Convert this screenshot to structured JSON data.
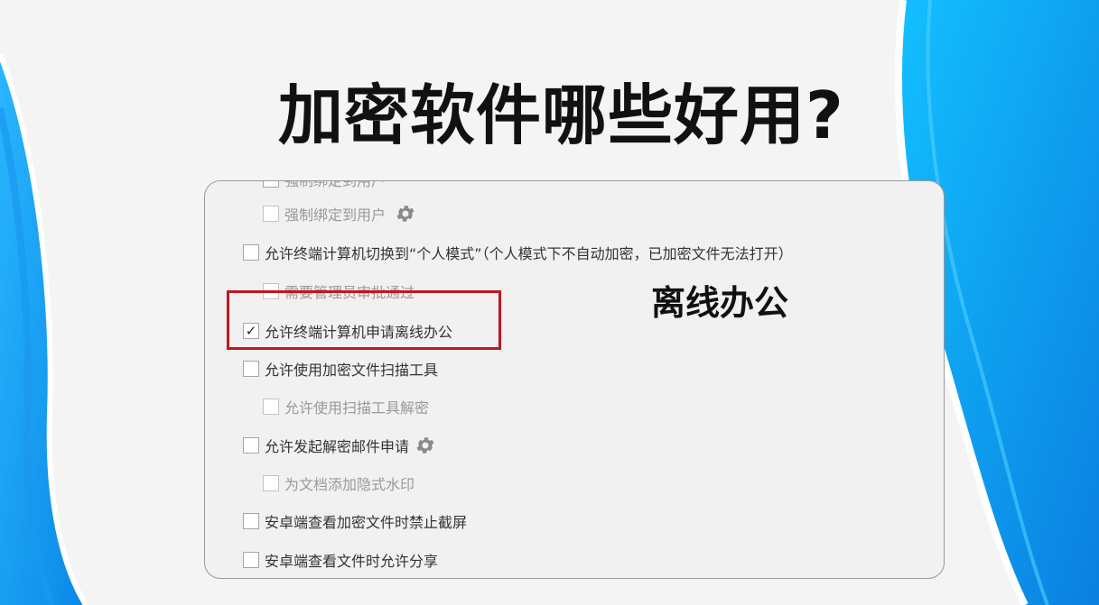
{
  "headline": "加密软件哪些好用?",
  "callout": "离线办公",
  "settings": {
    "clipped_label": "强制绑定到用户",
    "items": [
      {
        "label": "强制绑定到用户",
        "checked": false,
        "sub": true,
        "gear": true
      },
      {
        "label": "允许终端计算机切换到“个人模式”（个人模式下不自动加密，已加密文件无法打开）",
        "checked": false,
        "sub": false,
        "gear": false
      },
      {
        "label": "需要管理员审批通过",
        "checked": false,
        "sub": true,
        "gear": false
      },
      {
        "label": "允许终端计算机申请离线办公",
        "checked": true,
        "sub": false,
        "gear": false
      },
      {
        "label": "允许使用加密文件扫描工具",
        "checked": false,
        "sub": false,
        "gear": false
      },
      {
        "label": "允许使用扫描工具解密",
        "checked": false,
        "sub": true,
        "gear": false
      },
      {
        "label": "允许发起解密邮件申请",
        "checked": false,
        "sub": false,
        "gear": true
      },
      {
        "label": "为文档添加隐式水印",
        "checked": false,
        "sub": true,
        "gear": false
      },
      {
        "label": "安卓端查看加密文件时禁止截屏",
        "checked": false,
        "sub": false,
        "gear": false
      },
      {
        "label": "安卓端查看文件时允许分享",
        "checked": false,
        "sub": false,
        "gear": false
      }
    ]
  },
  "check_mark": "✓",
  "colors": {
    "accent_blue": "#1aa3f5",
    "highlight_red": "#c3161f"
  }
}
